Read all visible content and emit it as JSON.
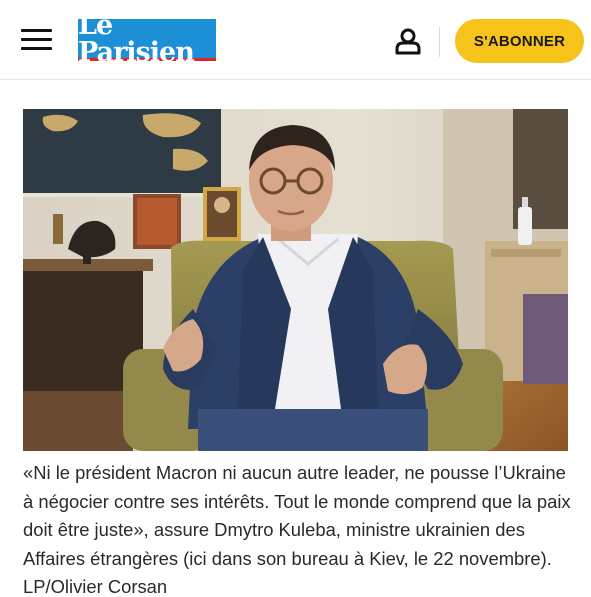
{
  "header": {
    "logo_text": "Le Parisien",
    "subscribe_label": "S'ABONNER",
    "accent_color": "#f6c31b",
    "logo_color": "#1d8fd6"
  },
  "article": {
    "caption": "«Ni le président Macron ni aucun autre leader, ne pousse l’Ukraine à négocier contre ses intérêts. Tout le monde comprend que la paix doit être juste», assure Dmytro Kuleba, ministre ukrainien des Affaires étrangères (ici dans son bureau à Kiev, le 22 novembre).",
    "credit": "LP/Olivier Corsan"
  },
  "icons": {
    "menu": "hamburger-menu-icon",
    "account": "user-account-icon"
  }
}
